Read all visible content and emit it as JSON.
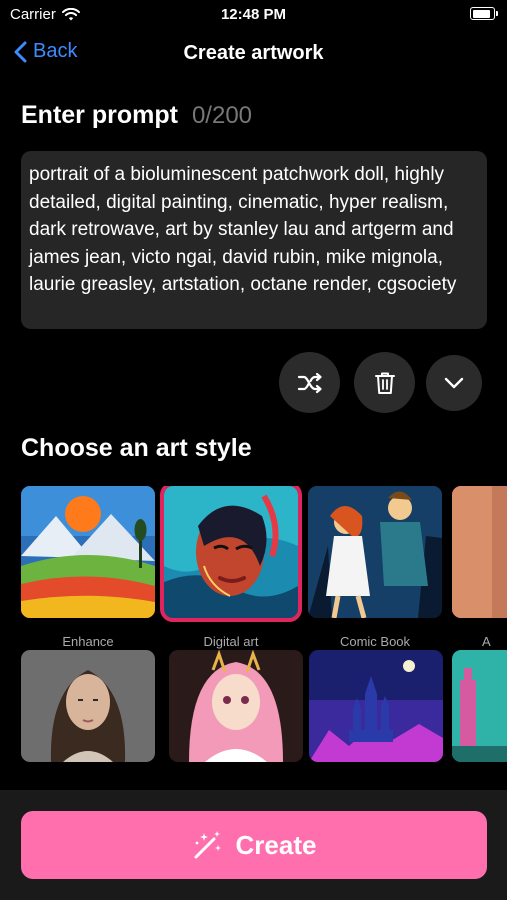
{
  "status_bar": {
    "carrier": "Carrier",
    "time": "12:48 PM",
    "battery_level": 0.9
  },
  "nav": {
    "back_label": "Back",
    "title": "Create artwork"
  },
  "prompt": {
    "heading": "Enter prompt",
    "counter": "0/200",
    "text": "portrait of a bioluminescent patchwork doll, highly detailed, digital painting, cinematic, hyper realism, dark retrowave, art by stanley lau and artgerm and james jean, victo ngai, david rubin, mike mignola, laurie greasley, artstation, octane render, cgsociety"
  },
  "actions": {
    "shuffle_icon": "shuffle-icon",
    "delete_icon": "trash-icon",
    "expand_icon": "chevron-down-icon"
  },
  "styles": {
    "heading": "Choose an art style",
    "selected": "Digital art",
    "row1": [
      {
        "label": "Enhance"
      },
      {
        "label": "Digital art"
      },
      {
        "label": "Comic Book"
      },
      {
        "label": "A"
      }
    ],
    "row2": [
      {
        "label": ""
      },
      {
        "label": ""
      },
      {
        "label": ""
      },
      {
        "label": ""
      }
    ]
  },
  "create": {
    "label": "Create",
    "icon": "sparkles-icon",
    "color": "#ff6fae"
  }
}
